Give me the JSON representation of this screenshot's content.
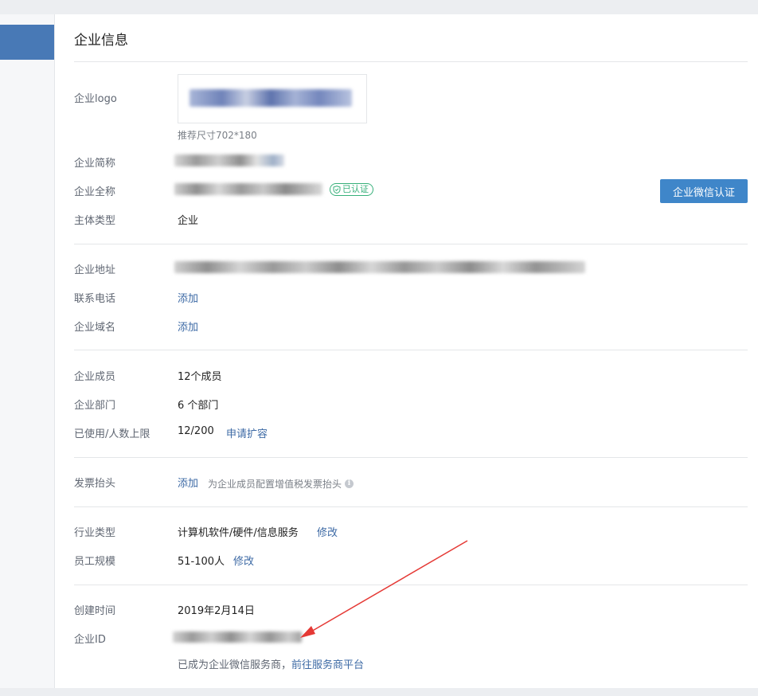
{
  "page_title": "企业信息",
  "logo": {
    "label": "企业logo",
    "hint": "推荐尺寸702*180"
  },
  "short_name": {
    "label": "企业简称"
  },
  "full_name": {
    "label": "企业全称",
    "verified_badge": "已认证",
    "verify_button": "企业微信认证"
  },
  "entity_type": {
    "label": "主体类型",
    "value": "企业"
  },
  "address": {
    "label": "企业地址"
  },
  "phone": {
    "label": "联系电话",
    "action": "添加"
  },
  "domain": {
    "label": "企业域名",
    "action": "添加"
  },
  "members": {
    "label": "企业成员",
    "value": "12个成员"
  },
  "departments": {
    "label": "企业部门",
    "value": "6 个部门"
  },
  "capacity": {
    "label": "已使用/人数上限",
    "value": "12/200",
    "action": "申请扩容"
  },
  "invoice": {
    "label": "发票抬头",
    "action": "添加",
    "note": "为企业成员配置增值税发票抬头"
  },
  "industry": {
    "label": "行业类型",
    "value": "计算机软件/硬件/信息服务",
    "action": "修改"
  },
  "scale": {
    "label": "员工规模",
    "value": "51-100人",
    "action": "修改"
  },
  "created": {
    "label": "创建时间",
    "value": "2019年2月14日"
  },
  "corp_id": {
    "label": "企业ID"
  },
  "footer": {
    "text": "已成为企业微信服务商，",
    "link": "前往服务商平台"
  },
  "colors": {
    "accent": "#3f86c9",
    "link": "#3d6aa5",
    "verified": "#37b07a",
    "sidebar_active": "#4879b6",
    "annotation_arrow": "#e53935"
  }
}
